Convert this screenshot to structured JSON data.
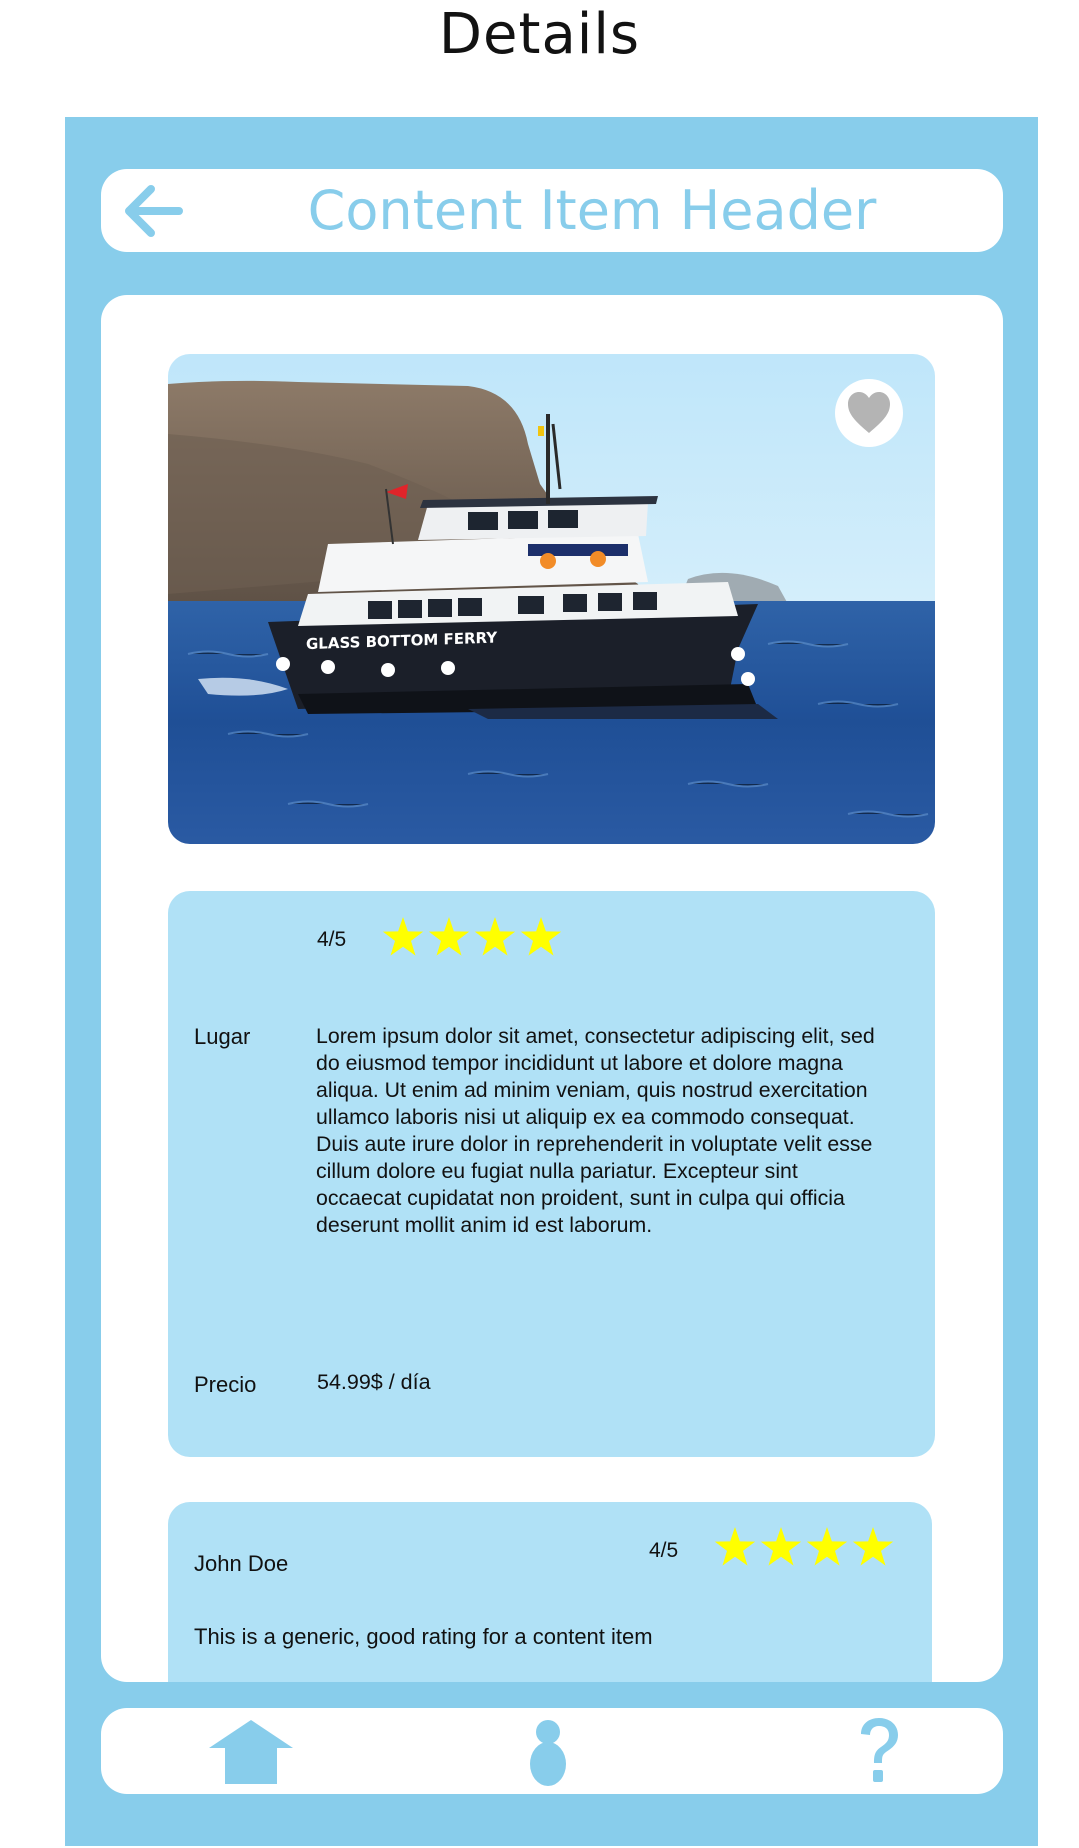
{
  "page_title": "Details",
  "header": {
    "title": "Content Item Header",
    "back_icon": "back-arrow-icon"
  },
  "item": {
    "image": "photo of a white and black ferry boat (Glass Bottom Ferry) sailing at sea near a rocky coast",
    "favorite_icon": "heart-icon",
    "rating_text": "4/5",
    "rating": 4,
    "place_label": "Lugar",
    "description": "Lorem ipsum dolor sit amet, consectetur adipiscing elit, sed do eiusmod tempor incididunt ut labore et dolore magna aliqua. Ut enim ad minim veniam, quis nostrud exercitation ullamco laboris nisi ut aliquip ex ea commodo consequat. Duis aute irure dolor in reprehenderit in voluptate velit esse cillum dolore eu fugiat nulla pariatur. Excepteur sint occaecat cupidatat non proident, sunt in culpa qui officia deserunt mollit anim id est laborum.",
    "price_label": "Precio",
    "price": "54.99$ / día"
  },
  "review": {
    "author": "John Doe",
    "rating_text": "4/5",
    "rating": 4,
    "text": "This is a generic, good rating for a content item"
  },
  "bottom_nav": {
    "items": [
      {
        "icon": "home-icon"
      },
      {
        "icon": "profile-icon"
      },
      {
        "icon": "help-icon"
      }
    ]
  },
  "colors": {
    "frame": "#88cdeb",
    "panel": "#b0e1f6",
    "star": "#ffff00",
    "heart": "#b4b4b4"
  }
}
